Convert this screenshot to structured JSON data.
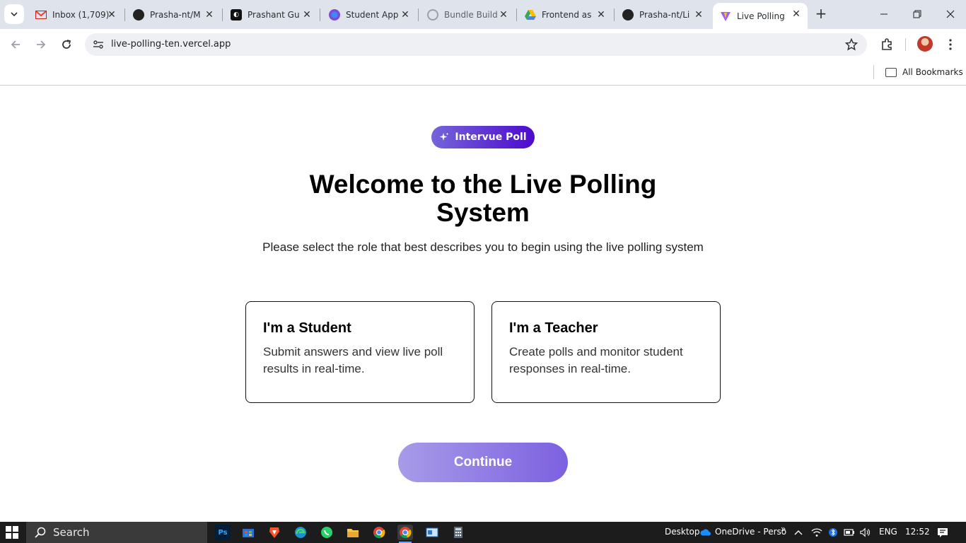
{
  "browser": {
    "tabs": [
      {
        "title": "Inbox (1,709)",
        "favicon": "gmail-icon"
      },
      {
        "title": "Prasha-nt/M",
        "favicon": "github-icon"
      },
      {
        "title": "Prashant Gu",
        "favicon": "app-icon"
      },
      {
        "title": "Student App",
        "favicon": "firefox-icon"
      },
      {
        "title": "Bundle Build",
        "favicon": "globe-icon"
      },
      {
        "title": "Frontend as",
        "favicon": "google-drive-icon"
      },
      {
        "title": "Prasha-nt/Li",
        "favicon": "github-icon"
      },
      {
        "title": "Live Polling",
        "favicon": "vite-icon"
      }
    ],
    "url": "live-polling-ten.vercel.app",
    "bookmarks_label": "All Bookmarks"
  },
  "page": {
    "brand_label": "Intervue Poll",
    "heading_prefix": "Welcome to the ",
    "heading_bold": "Live Polling System",
    "subtitle": "Please select the role that best describes you to begin using the live polling system",
    "roles": [
      {
        "title": "I'm a Student",
        "description": "Submit answers and view live poll results in real-time."
      },
      {
        "title": "I'm a Teacher",
        "description": "Create polls and monitor student responses in real-time."
      }
    ],
    "continue_label": "Continue"
  },
  "taskbar": {
    "search_label": "Search",
    "desktop_label": "Desktop",
    "onedrive_label": "OneDrive - Perso",
    "overflow_label": "»",
    "language": "ENG",
    "time": "12:52",
    "apps": [
      "photoshop",
      "store",
      "brave",
      "edge",
      "whatsapp",
      "file-explorer",
      "chrome",
      "chrome-active",
      "desktop-app",
      "calculator"
    ]
  },
  "colors": {
    "brand_gradient_start": "#7565d9",
    "brand_gradient_end": "#4d0acd",
    "continue_start": "#a89be8",
    "continue_end": "#7c61e0"
  }
}
